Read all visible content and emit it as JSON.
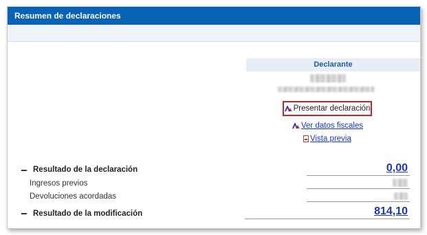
{
  "header": {
    "title": "Resumen de declaraciones"
  },
  "declarante": {
    "heading": "Declarante"
  },
  "actions": {
    "presentar": "Presentar declaración",
    "ver_datos": "Ver datos fiscales",
    "vista_previa": "Vista previa"
  },
  "results": [
    {
      "label": "Resultado de la declaración",
      "value": "0,00"
    },
    {
      "label": "Ingresos previos"
    },
    {
      "label": "Devoluciones acordadas"
    },
    {
      "label": "Resultado de la modificación",
      "value": "814,10"
    }
  ],
  "colors": {
    "header_bg": "#0a62b6",
    "link": "#1a35c8",
    "highlight_border": "#d41f1f"
  },
  "icons": {
    "presentar": "aeat-logo-icon",
    "ver_datos": "aeat-logo-icon",
    "vista_previa": "pdf-icon",
    "result_rows": "hand-pointer-icon"
  }
}
